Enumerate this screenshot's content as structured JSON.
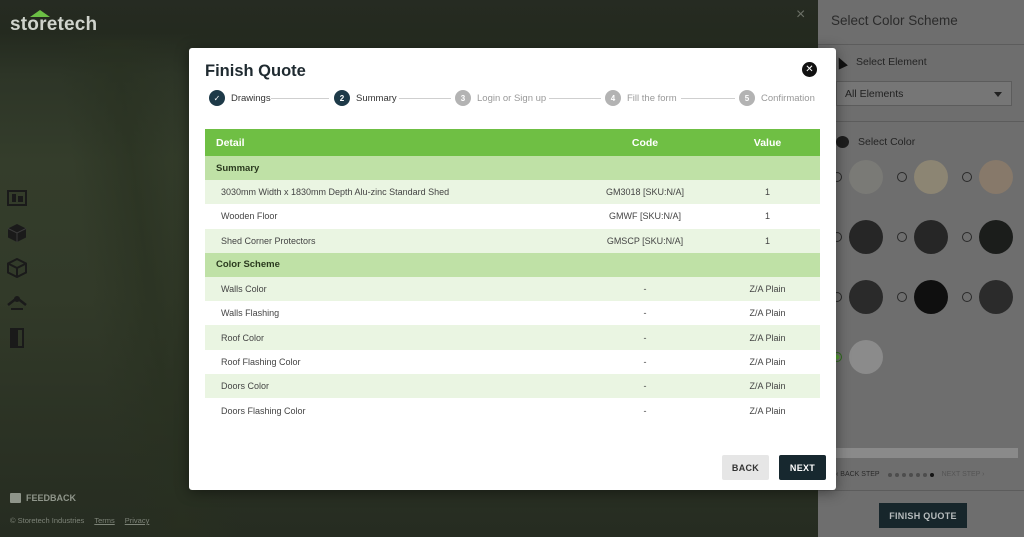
{
  "app": {
    "logo_text": "storetech"
  },
  "background": {
    "close_glyph": "×",
    "left_tools": [
      {
        "icon": "dimensions-icon"
      },
      {
        "icon": "cube-icon"
      },
      {
        "icon": "cube-outline-icon"
      },
      {
        "icon": "roof-icon"
      },
      {
        "icon": "door-icon"
      }
    ],
    "feedback_label": "FEEDBACK",
    "footer": {
      "copyright": "© Storetech Industries",
      "terms": "Terms",
      "privacy": "Privacy"
    }
  },
  "right_panel": {
    "title": "Select Color Scheme",
    "select_element_label": "Select Element",
    "element_dropdown_value": "All Elements",
    "select_color_label": "Select Color",
    "swatch_rows": [
      [
        {
          "color": "#7a7a76",
          "selected": false
        },
        {
          "color": "#8c8573",
          "selected": false
        },
        {
          "color": "#87796a",
          "selected": false
        }
      ],
      [
        {
          "color": "#262626",
          "selected": false
        },
        {
          "color": "#262626",
          "selected": false
        },
        {
          "color": "#1b1d1b",
          "selected": false
        }
      ],
      [
        {
          "color": "#2a2a2a",
          "selected": false
        },
        {
          "color": "#0f0f0f",
          "selected": false
        },
        {
          "color": "#2b2b2b",
          "selected": false
        }
      ],
      [
        {
          "color": "#8b8b8b",
          "selected": true
        }
      ]
    ],
    "back_step_label": "BACK STEP",
    "next_step_label": "NEXT STEP",
    "step_dots": 7,
    "current_dot": 7,
    "finish_button_label": "FINISH QUOTE"
  },
  "modal": {
    "title": "Finish Quote",
    "close_glyph": "✕",
    "steps": [
      {
        "num": "✓",
        "label": "Drawings",
        "state": "done"
      },
      {
        "num": "2",
        "label": "Summary",
        "state": "active"
      },
      {
        "num": "3",
        "label": "Login or Sign up",
        "state": "todo"
      },
      {
        "num": "4",
        "label": "Fill the form",
        "state": "todo"
      },
      {
        "num": "5",
        "label": "Confirmation",
        "state": "todo"
      }
    ],
    "table": {
      "headers": {
        "detail": "Detail",
        "code": "Code",
        "value": "Value"
      },
      "sections": [
        {
          "title": "Summary",
          "rows": [
            {
              "detail": "3030mm Width x 1830mm Depth Alu-zinc Standard Shed",
              "code": "GM3018 [SKU:N/A]",
              "value": "1"
            },
            {
              "detail": "Wooden Floor",
              "code": "GMWF [SKU:N/A]",
              "value": "1"
            },
            {
              "detail": "Shed Corner Protectors",
              "code": "GMSCP [SKU:N/A]",
              "value": "1"
            }
          ]
        },
        {
          "title": "Color Scheme",
          "rows": [
            {
              "detail": "Walls Color",
              "code": "-",
              "value": "Z/A Plain"
            },
            {
              "detail": "Walls Flashing",
              "code": "-",
              "value": "Z/A Plain"
            },
            {
              "detail": "Roof Color",
              "code": "-",
              "value": "Z/A Plain"
            },
            {
              "detail": "Roof Flashing Color",
              "code": "-",
              "value": "Z/A Plain"
            },
            {
              "detail": "Doors Color",
              "code": "-",
              "value": "Z/A Plain"
            },
            {
              "detail": "Doors Flashing Color",
              "code": "-",
              "value": "Z/A Plain"
            }
          ]
        }
      ]
    },
    "back_label": "BACK",
    "next_label": "NEXT"
  }
}
